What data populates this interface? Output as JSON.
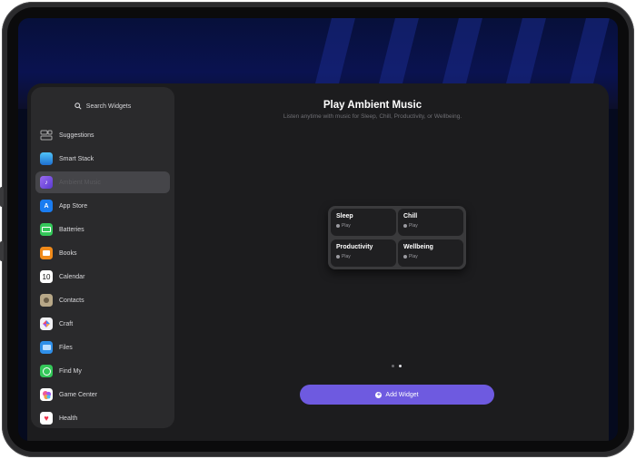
{
  "search": {
    "label": "Search Widgets"
  },
  "sidebar": {
    "items": [
      {
        "label": "Suggestions",
        "icon": "suggestions-icon",
        "color": "#2a2a2c"
      },
      {
        "label": "Smart Stack",
        "icon": "smart-stack-icon",
        "color": "#2f8fd8"
      },
      {
        "label": "Ambient Music",
        "icon": "ambient-music-icon",
        "color": "#7b4ad8"
      },
      {
        "label": "App Store",
        "icon": "app-store-icon",
        "color": "#1a7cf0"
      },
      {
        "label": "Batteries",
        "icon": "batteries-icon",
        "color": "#34c759"
      },
      {
        "label": "Books",
        "icon": "books-icon",
        "color": "#f08a1a"
      },
      {
        "label": "Calendar",
        "icon": "calendar-icon",
        "color": "#ffffff",
        "glyph": "10"
      },
      {
        "label": "Contacts",
        "icon": "contacts-icon",
        "color": "#b8a888"
      },
      {
        "label": "Craft",
        "icon": "craft-icon",
        "color": "#e8e8ec"
      },
      {
        "label": "Files",
        "icon": "files-icon",
        "color": "#2f8fe8"
      },
      {
        "label": "Find My",
        "icon": "find-my-icon",
        "color": "#34c759"
      },
      {
        "label": "Game Center",
        "icon": "game-center-icon",
        "color": "#e85a9a"
      },
      {
        "label": "Health",
        "icon": "health-icon",
        "color": "#ffffff"
      }
    ]
  },
  "main": {
    "title": "Play Ambient Music",
    "subtitle": "Listen anytime with music for Sleep, Chill, Productivity, or Wellbeing.",
    "tiles": [
      {
        "title": "Sleep",
        "action": "Play"
      },
      {
        "title": "Chill",
        "action": "Play"
      },
      {
        "title": "Productivity",
        "action": "Play"
      },
      {
        "title": "Wellbeing",
        "action": "Play"
      }
    ],
    "add_button": "Add Widget"
  }
}
